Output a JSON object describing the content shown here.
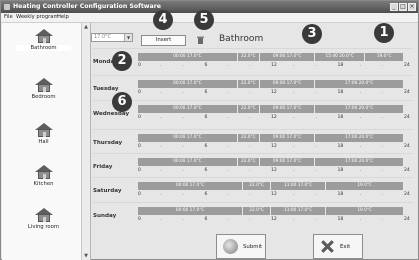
{
  "window": {
    "title": "Heating Controller Configuration Software"
  },
  "menu": [
    "File",
    "Weekly program",
    "Help"
  ],
  "rooms": [
    "Bathroom",
    "Bedroom",
    "Hall",
    "Kitchen",
    "Living room"
  ],
  "toolbar": {
    "temp_value": "17.0°C",
    "insert_label": "Insert",
    "room_title": "Bathroom"
  },
  "days": [
    {
      "name": "Monday",
      "segments": [
        {
          "label": "00:00 17.0°C",
          "start": 0,
          "end": 9
        },
        {
          "label": "22.0°C",
          "start": 9,
          "end": 11
        },
        {
          "label": "09:00 17.0°C",
          "start": 11,
          "end": 16
        },
        {
          "label": "15:40 20.0°C",
          "start": 16,
          "end": 20.5
        },
        {
          "label": "19.0°C",
          "start": 20.5,
          "end": 24
        }
      ]
    },
    {
      "name": "Tuesday",
      "segments": [
        {
          "label": "00:00 17.0°C",
          "start": 0,
          "end": 9
        },
        {
          "label": "22.0°C",
          "start": 9,
          "end": 11
        },
        {
          "label": "09:00 17.0°C",
          "start": 11,
          "end": 16
        },
        {
          "label": "17:00 20.0°C",
          "start": 16,
          "end": 24
        }
      ]
    },
    {
      "name": "Wednesday",
      "segments": [
        {
          "label": "00:00 17.0°C",
          "start": 0,
          "end": 9
        },
        {
          "label": "22.0°C",
          "start": 9,
          "end": 11
        },
        {
          "label": "09:00 17.0°C",
          "start": 11,
          "end": 16
        },
        {
          "label": "17:00 20.0°C",
          "start": 16,
          "end": 24
        }
      ]
    },
    {
      "name": "Thursday",
      "segments": [
        {
          "label": "00:00 17.0°C",
          "start": 0,
          "end": 9
        },
        {
          "label": "22.0°C",
          "start": 9,
          "end": 11
        },
        {
          "label": "09:00 17.0°C",
          "start": 11,
          "end": 16
        },
        {
          "label": "17:00 20.0°C",
          "start": 16,
          "end": 24
        }
      ]
    },
    {
      "name": "Friday",
      "segments": [
        {
          "label": "00:00 17.0°C",
          "start": 0,
          "end": 9
        },
        {
          "label": "22.0°C",
          "start": 9,
          "end": 11
        },
        {
          "label": "09:00 17.0°C",
          "start": 11,
          "end": 16
        },
        {
          "label": "17:00 20.0°C",
          "start": 16,
          "end": 24
        }
      ]
    },
    {
      "name": "Saturday",
      "segments": [
        {
          "label": "00:00 17.0°C",
          "start": 0,
          "end": 9.5
        },
        {
          "label": "22.0°C",
          "start": 9.5,
          "end": 12
        },
        {
          "label": "11:00 17.0°C",
          "start": 12,
          "end": 17
        },
        {
          "label": "19.0°C",
          "start": 17,
          "end": 24
        }
      ]
    },
    {
      "name": "Sunday",
      "segments": [
        {
          "label": "00:00 17.0°C",
          "start": 0,
          "end": 9.5
        },
        {
          "label": "22.0°C",
          "start": 9.5,
          "end": 12
        },
        {
          "label": "11:00 17.0°C",
          "start": 12,
          "end": 17
        },
        {
          "label": "19.0°C",
          "start": 17,
          "end": 24
        }
      ]
    }
  ],
  "scale_labels": [
    "0",
    "6",
    "12",
    "18",
    "24"
  ],
  "scale_dots": ".",
  "buttons": {
    "submit": "Submit",
    "exit": "Exit"
  },
  "callouts": [
    "1",
    "2",
    "3",
    "4",
    "5",
    "6"
  ]
}
